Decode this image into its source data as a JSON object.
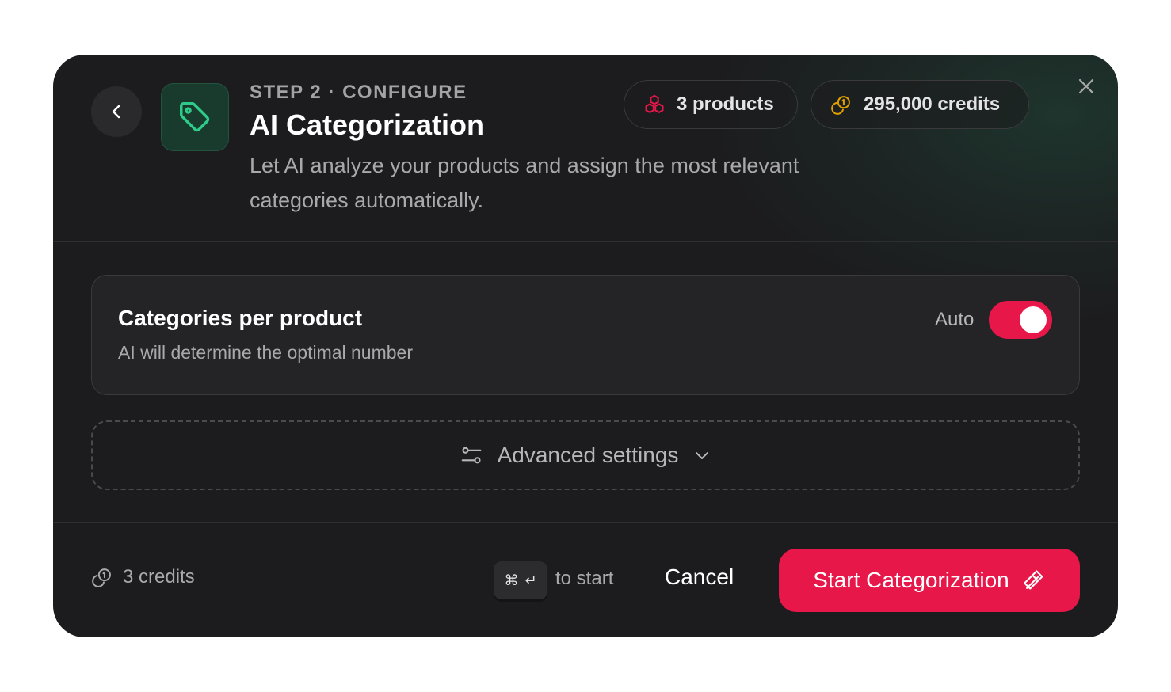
{
  "header": {
    "step_label": "STEP 2 · CONFIGURE",
    "title": "AI Categorization",
    "description": "Let AI analyze your products and assign the most relevant categories automatically.",
    "products_pill": "3 products",
    "credits_pill": "295,000 credits"
  },
  "setting": {
    "title": "Categories per product",
    "subtitle": "AI will determine the optimal number",
    "toggle_label": "Auto",
    "toggle_on": true
  },
  "advanced": {
    "label": "Advanced settings"
  },
  "footer": {
    "credits_cost": "3 credits",
    "shortcut_hint": "to start",
    "cancel_label": "Cancel",
    "start_label": "Start Categorization"
  },
  "colors": {
    "accent": "#e8174a",
    "brand_green": "#2ecc8a",
    "credit_gold": "#e0a100"
  },
  "icons": [
    "chevron-left-icon",
    "tag-icon",
    "boxes-icon",
    "coins-icon",
    "close-icon",
    "sliders-icon",
    "chevron-down-icon",
    "command-icon",
    "enter-icon",
    "wand-icon"
  ]
}
